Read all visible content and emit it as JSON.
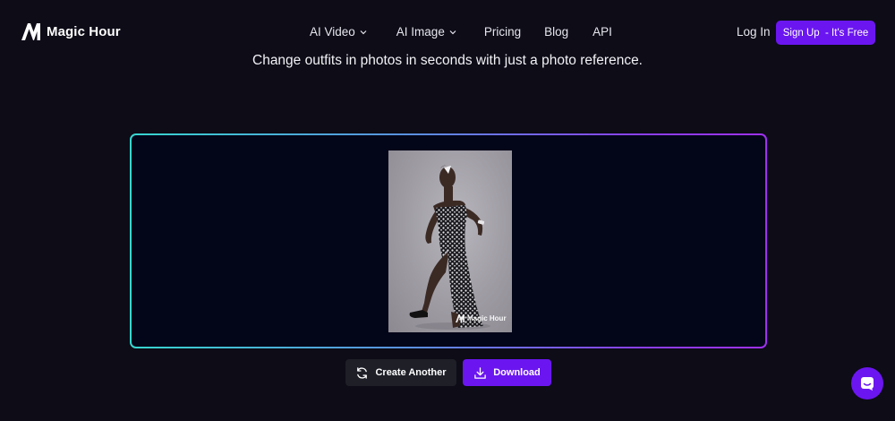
{
  "nav": {
    "brand": "Magic Hour",
    "logo_icon": "magic-hour-logo-icon",
    "menu": [
      {
        "label": "AI Video",
        "has_dropdown": true
      },
      {
        "label": "AI Image",
        "has_dropdown": true
      },
      {
        "label": "Pricing",
        "has_dropdown": false
      },
      {
        "label": "Blog",
        "has_dropdown": false
      },
      {
        "label": "API",
        "has_dropdown": false
      }
    ],
    "login_label": "Log In",
    "signup_label": "Sign Up  - It's Free"
  },
  "subtitle": "Change outfits in photos in seconds with just a photo reference.",
  "result": {
    "image_alt": "Generated photo of a woman in a black and white patterned strapless gown",
    "watermark": "Magic Hour"
  },
  "actions": {
    "create_another_label": "Create Another",
    "create_another_icon": "refresh-icon",
    "download_label": "Download",
    "download_icon": "download-icon"
  },
  "chat": {
    "icon": "chat-icon"
  },
  "colors": {
    "background": "#0d0c17",
    "accent": "#6b16f0",
    "frame_gradient_start": "#36d6cf",
    "frame_gradient_end": "#9f30f2",
    "secondary_button": "#1e1f27"
  }
}
